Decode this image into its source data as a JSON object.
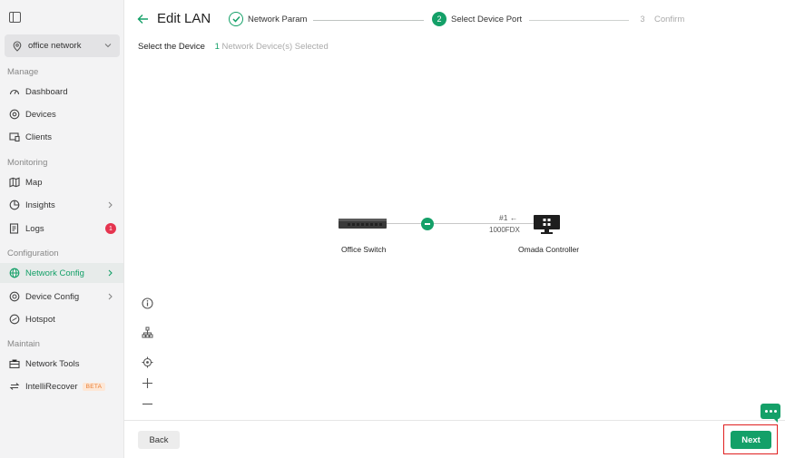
{
  "sidebar": {
    "site_name": "office network",
    "sections": {
      "manage": "Manage",
      "monitoring": "Monitoring",
      "configuration": "Configuration",
      "maintain": "Maintain"
    },
    "items": {
      "dashboard": "Dashboard",
      "devices": "Devices",
      "clients": "Clients",
      "map": "Map",
      "insights": "Insights",
      "logs": "Logs",
      "network_config": "Network Config",
      "device_config": "Device Config",
      "hotspot": "Hotspot",
      "network_tools": "Network Tools",
      "intellirecover": "IntelliRecover"
    },
    "logs_badge": "1",
    "beta_label": "BETA"
  },
  "header": {
    "title": "Edit LAN",
    "steps": [
      {
        "number": "",
        "label": "Network Param"
      },
      {
        "number": "2",
        "label": "Select Device Port"
      },
      {
        "number": "3",
        "label": "Confirm"
      }
    ]
  },
  "selection": {
    "label": "Select the Device",
    "count": "1",
    "count_suffix": "Network Device(s) Selected"
  },
  "topology": {
    "switch_name": "Office Switch",
    "controller_name": "Omada Controller",
    "port": "#1 ←",
    "speed": "1000FDX"
  },
  "footer": {
    "back_label": "Back",
    "next_label": "Next"
  },
  "colors": {
    "accent": "#14a068",
    "badge": "#e5344f",
    "highlight_box": "#e02020"
  }
}
